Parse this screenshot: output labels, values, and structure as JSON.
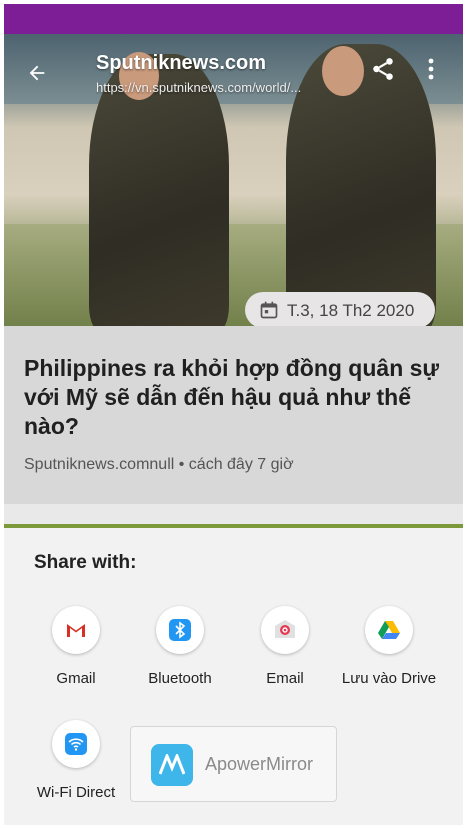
{
  "status_bar": {
    "color": "#7d1e96"
  },
  "article": {
    "site_title": "Sputniknews.com",
    "site_url": "https://vn.sputniknews.com/world/...",
    "date": "T.3, 18 Th2 2020",
    "headline": "Philippines ra khỏi hợp đồng quân sự với Mỹ sẽ dẫn đến hậu quả như thế nào?",
    "meta": "Sputniknews.comnull • cách đây 7 giờ"
  },
  "share_sheet": {
    "title": "Share with:",
    "apps": [
      {
        "label": "Gmail",
        "icon": "gmail-icon"
      },
      {
        "label": "Bluetooth",
        "icon": "bluetooth-icon"
      },
      {
        "label": "Email",
        "icon": "email-icon"
      },
      {
        "label": "Lưu vào Drive",
        "icon": "drive-icon"
      },
      {
        "label": "Wi-Fi Direct",
        "icon": "wifi-direct-icon"
      }
    ],
    "recent_app": {
      "label": "ApowerMirror",
      "icon": "apowermirror-icon"
    }
  },
  "colors": {
    "accent_green": "#7d9a3a",
    "bluetooth_blue": "#2196f3"
  }
}
